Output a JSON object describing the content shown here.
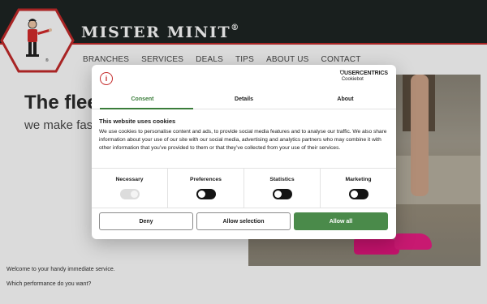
{
  "site": {
    "brand": "MISTER MINIT",
    "brand_mark": "®",
    "nav": [
      "BRANCHES",
      "SERVICES",
      "DEALS",
      "TIPS",
      "ABOUT US",
      "CONTACT"
    ],
    "hero_title": "The flee",
    "hero_sub": "we make fas",
    "welcome": "Welcome to your handy immediate service.",
    "question": "Which performance do you want?"
  },
  "dialog": {
    "provider_name": "USERCENTRICS",
    "provider_sub": "Cookiebot",
    "tabs": [
      {
        "label": "Consent",
        "active": true
      },
      {
        "label": "Details",
        "active": false
      },
      {
        "label": "About",
        "active": false
      }
    ],
    "heading": "This website uses cookies",
    "body": "We use cookies to personalise content and ads, to provide social media features and to analyse our traffic. We also share information about your use of our site with our social media, advertising and analytics partners who may combine it with other information that you’ve provided to them or that they’ve collected from your use of their services.",
    "toggles": [
      {
        "label": "Necessary",
        "enabled": true,
        "disabled": true
      },
      {
        "label": "Preferences",
        "enabled": false,
        "disabled": false
      },
      {
        "label": "Statistics",
        "enabled": false,
        "disabled": false
      },
      {
        "label": "Marketing",
        "enabled": false,
        "disabled": false
      }
    ],
    "buttons": {
      "deny": "Deny",
      "allow_selection": "Allow selection",
      "allow_all": "Allow all"
    }
  },
  "colors": {
    "header_bg": "#1e2523",
    "accent_red": "#c42a2a",
    "accent_green": "#4a8a4a"
  }
}
